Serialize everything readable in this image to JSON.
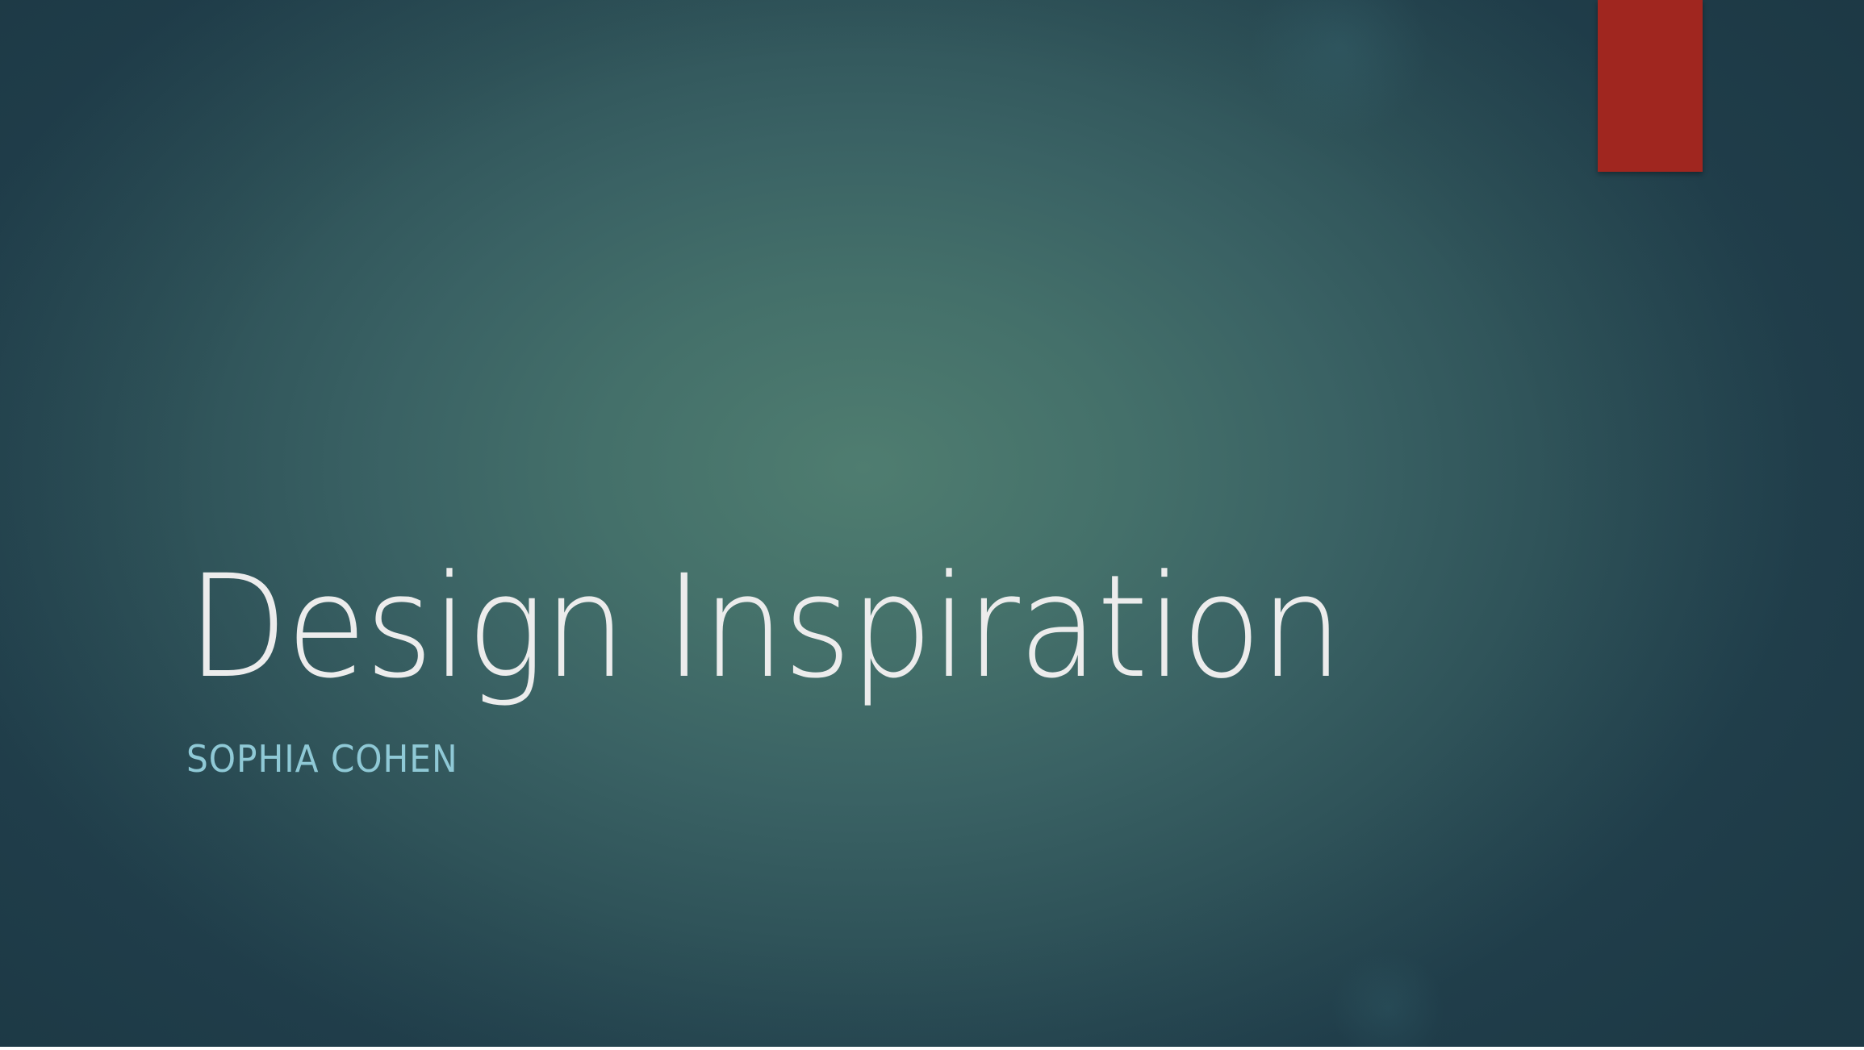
{
  "slide": {
    "title": "Design Inspiration",
    "subtitle": "SOPHIA COHEN"
  },
  "colors": {
    "background_center": "#4f7d70",
    "background_edge": "#23424f",
    "accent_tab": "#a0261f",
    "title_text": "#ececec",
    "subtitle_text": "#8fc9d6"
  }
}
